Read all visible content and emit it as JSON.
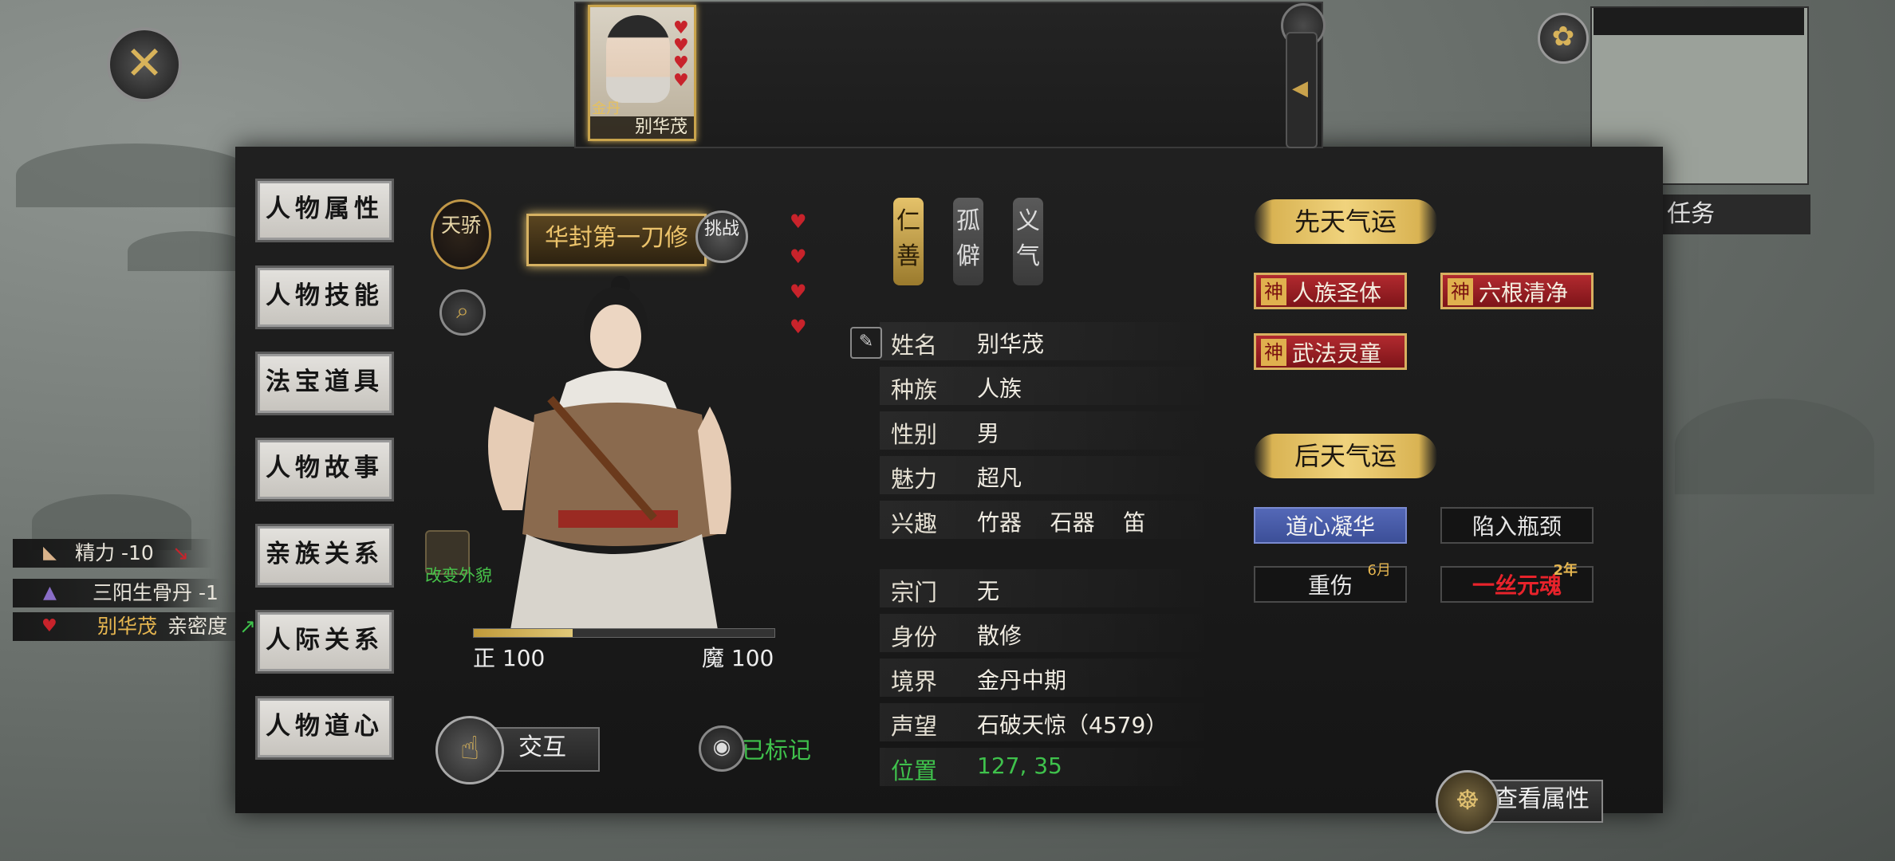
{
  "window": {
    "close_label": "✕"
  },
  "top_strip": {
    "portrait_name": "别华茂",
    "portrait_badge": "金丹",
    "hearts": 4
  },
  "menu": {
    "items": [
      {
        "label": "人物属性"
      },
      {
        "label": "人物技能"
      },
      {
        "label": "法宝道具"
      },
      {
        "label": "人物故事"
      },
      {
        "label": "亲族关系"
      },
      {
        "label": "人际关系"
      },
      {
        "label": "人物道心"
      }
    ]
  },
  "character": {
    "badge": "天骄",
    "title": "华封第一刀修",
    "challenge": "挑战",
    "zheng": "正 100",
    "mo": "魔 100",
    "change_look": "改变外貌",
    "interact": "交互",
    "marked": "已标记",
    "alignment_fraction": 0.33,
    "hearts": 4
  },
  "traits": [
    "仁善",
    "孤僻",
    "义气"
  ],
  "info": [
    {
      "label": "姓名",
      "value": "别华茂"
    },
    {
      "label": "种族",
      "value": "人族"
    },
    {
      "label": "性别",
      "value": "男"
    },
    {
      "label": "魅力",
      "value": "超凡"
    },
    {
      "label": "兴趣",
      "value": "竹器    石器    笛"
    },
    {
      "label": "宗门",
      "value": "无"
    },
    {
      "label": "身份",
      "value": "散修"
    },
    {
      "label": "境界",
      "value": "金丹中期"
    },
    {
      "label": "声望",
      "value": "石破天惊（4579）"
    },
    {
      "label": "位置",
      "value": "127, 35"
    }
  ],
  "innate": {
    "title": "先天气运",
    "tags": [
      {
        "mark": "神",
        "label": "人族圣体"
      },
      {
        "mark": "神",
        "label": "六根清净"
      },
      {
        "mark": "神",
        "label": "武法灵童"
      }
    ]
  },
  "acquired": {
    "title": "后天气运",
    "tags": [
      {
        "label": "道心凝华",
        "style": "blue"
      },
      {
        "label": "陷入瓶颈",
        "style": "dark"
      },
      {
        "label": "重伤",
        "sub": "6月",
        "style": "dark"
      },
      {
        "label": "一丝元魂",
        "sub": "2年",
        "style": "dark-red"
      }
    ]
  },
  "view_attr": "查看属性",
  "notifications": [
    {
      "icon": "arm-icon",
      "text": "精力 -10"
    },
    {
      "icon": "hat-icon",
      "text": "三阳生骨丹 -1"
    },
    {
      "icon": "heart-icon",
      "name": "别华茂",
      "text": "亲密度"
    }
  ],
  "colors": {
    "accent_gold": "#d9b353",
    "positive_green": "#3fc24c",
    "heart_red": "#c8232b",
    "blue_tag": "#4a5ea8"
  },
  "right_hud": {
    "task_label": "任务"
  }
}
